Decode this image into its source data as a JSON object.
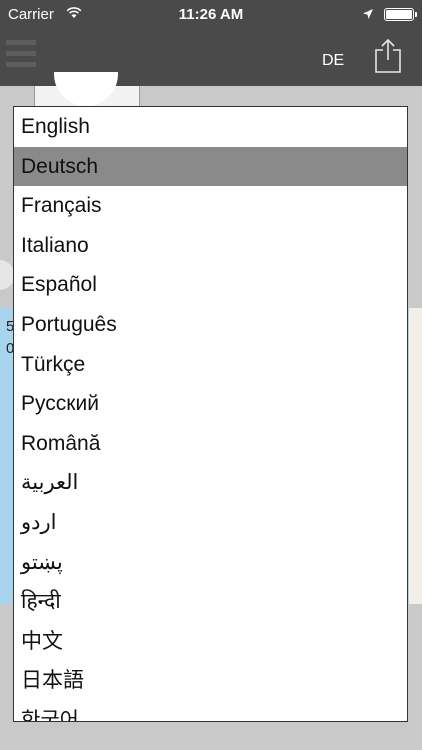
{
  "status_bar": {
    "carrier": "Carrier",
    "time": "11:26 AM"
  },
  "nav_bar": {
    "language_code": "DE"
  },
  "left_content_text": [
    "5",
    "0"
  ],
  "picker": {
    "selected_index": 1,
    "items": [
      "English",
      "Deutsch",
      "Français",
      "Italiano",
      "Español",
      "Português",
      "Türkçe",
      "Русский",
      "Română",
      "العربية",
      "اردو",
      "پښتو",
      "हिन्दी",
      "中文",
      "日本語",
      "한국어"
    ]
  }
}
